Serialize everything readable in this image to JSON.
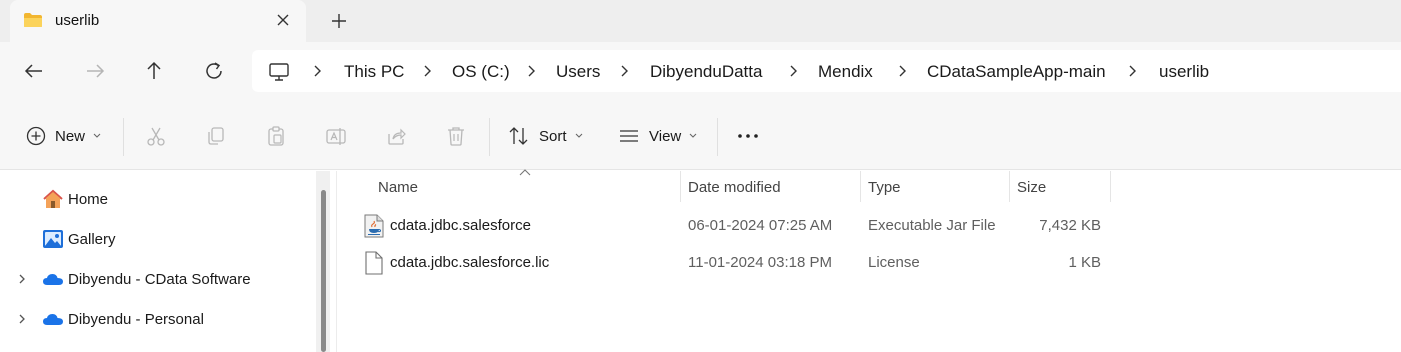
{
  "tab": {
    "title": "userlib"
  },
  "address": {
    "crumbs": [
      "This PC",
      "OS (C:)",
      "Users",
      "DibyenduDatta",
      "Mendix",
      "CDataSampleApp-main",
      "userlib"
    ]
  },
  "toolbar": {
    "new_label": "New",
    "sort_label": "Sort",
    "view_label": "View"
  },
  "nav": {
    "items": [
      {
        "label": "Home",
        "icon": "home-icon"
      },
      {
        "label": "Gallery",
        "icon": "gallery-icon"
      },
      {
        "label": "Dibyendu - CData Software",
        "icon": "onedrive-cloud-icon"
      },
      {
        "label": "Dibyendu - Personal",
        "icon": "onedrive-cloud-icon"
      }
    ]
  },
  "columns": {
    "name": "Name",
    "date": "Date modified",
    "type": "Type",
    "size": "Size"
  },
  "files": [
    {
      "name": "cdata.jdbc.salesforce",
      "date": "06-01-2024 07:25 AM",
      "type": "Executable Jar File",
      "size": "7,432 KB",
      "icon": "java-jar-icon"
    },
    {
      "name": "cdata.jdbc.salesforce.lic",
      "date": "11-01-2024 03:18 PM",
      "type": "License",
      "size": "1 KB",
      "icon": "blank-file-icon"
    }
  ],
  "colors": {
    "accent": "#0067c0",
    "folder": "#f8c94a",
    "onedrive": "#1a73e8"
  }
}
